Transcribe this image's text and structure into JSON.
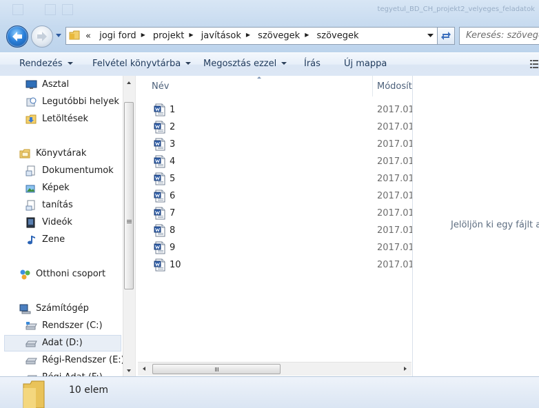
{
  "window": {
    "title": "tegyetul_BD_CH_projekt2_velyeges_feladatok"
  },
  "address": {
    "overflow_marker": "«",
    "crumbs": [
      "jogi ford",
      "projekt",
      "javítások",
      "szövegek",
      "szövegek"
    ]
  },
  "search": {
    "placeholder": "Keresés: szövegek"
  },
  "toolbar": {
    "organize": "Rendezés",
    "include_library": "Felvétel könyvtárba",
    "share_with": "Megosztás ezzel",
    "burn": "Írás",
    "new_folder": "Új mappa"
  },
  "nav": {
    "favorites": [
      {
        "label": "Asztal",
        "icon": "desktop-icon"
      },
      {
        "label": "Legutóbbi helyek",
        "icon": "recent-places-icon"
      },
      {
        "label": "Letöltések",
        "icon": "downloads-icon"
      }
    ],
    "libraries": {
      "label": "Könyvtárak",
      "items": [
        {
          "label": "Dokumentumok",
          "icon": "documents-icon"
        },
        {
          "label": "Képek",
          "icon": "pictures-icon"
        },
        {
          "label": "tanítás",
          "icon": "library-icon"
        },
        {
          "label": "Videók",
          "icon": "videos-icon"
        },
        {
          "label": "Zene",
          "icon": "music-icon"
        }
      ]
    },
    "homegroup": "Otthoni csoport",
    "computer": {
      "label": "Számítógép",
      "drives": [
        {
          "label": "Rendszer (C:)",
          "icon": "system-drive-icon"
        },
        {
          "label": "Adat (D:)",
          "icon": "drive-icon",
          "selected": true
        },
        {
          "label": "Régi-Rendszer (E:)",
          "icon": "drive-icon"
        },
        {
          "label": "Régi-Adat (F:)",
          "icon": "drive-icon"
        }
      ]
    }
  },
  "filelist": {
    "columns": {
      "name": "Név",
      "modified": "Módosít"
    },
    "files": [
      {
        "name": "1",
        "modified": "2017.01"
      },
      {
        "name": "2",
        "modified": "2017.01"
      },
      {
        "name": "3",
        "modified": "2017.01"
      },
      {
        "name": "4",
        "modified": "2017.01"
      },
      {
        "name": "5",
        "modified": "2017.01"
      },
      {
        "name": "6",
        "modified": "2017.01"
      },
      {
        "name": "7",
        "modified": "2017.01"
      },
      {
        "name": "8",
        "modified": "2017.01"
      },
      {
        "name": "9",
        "modified": "2017.01"
      },
      {
        "name": "10",
        "modified": "2017.01"
      }
    ]
  },
  "preview": {
    "message": "Jelöljön ki egy fájlt a b"
  },
  "status": {
    "count": "10 elem"
  }
}
